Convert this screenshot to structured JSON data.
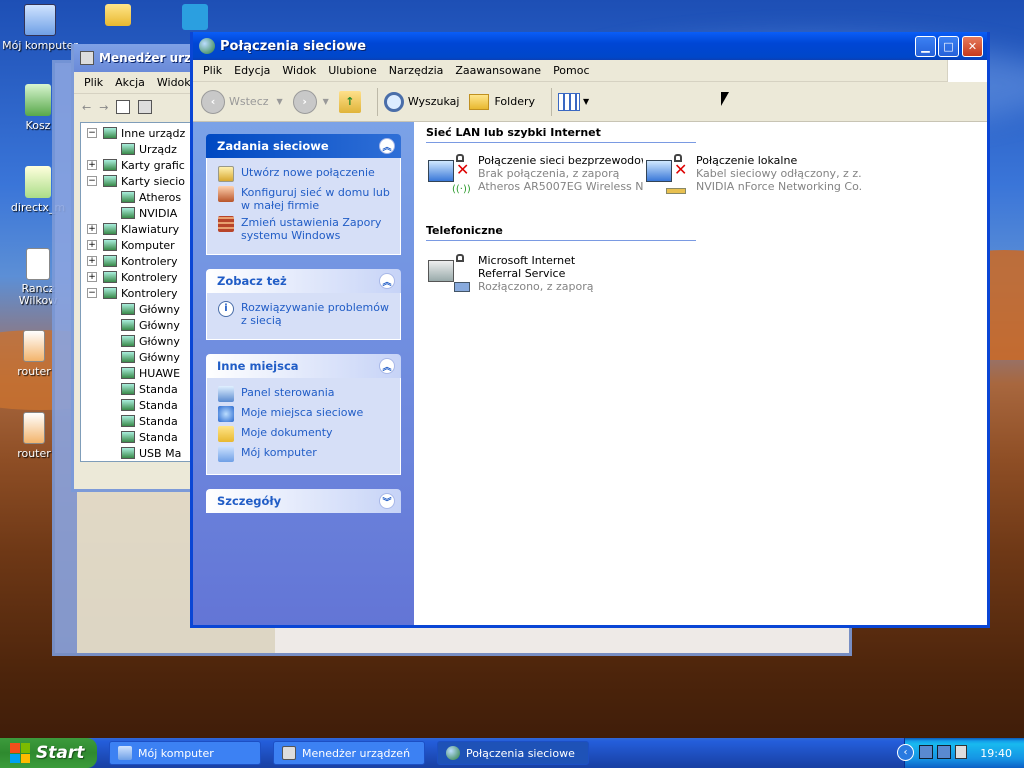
{
  "desktop": {
    "icons": [
      {
        "label": "Mój komputer"
      },
      {
        "label": "Kosz"
      },
      {
        "label": "directx_m"
      },
      {
        "label": "Rancz Wilkow"
      },
      {
        "label": "router"
      },
      {
        "label": "router"
      }
    ]
  },
  "devmgr": {
    "title": "Menedżer urzą",
    "menu": [
      "Plik",
      "Akcja",
      "Widok"
    ],
    "tree": [
      "Inne urządz",
      "Urządz",
      "Karty grafic",
      "Karty siecio",
      "Atheros",
      "NVIDIA",
      "Klawiatury",
      "Komputer",
      "Kontrolery",
      "Kontrolery",
      "Kontrolery",
      "Główny",
      "Główny",
      "Główny",
      "Główny",
      "HUAWE",
      "Standa",
      "Standa",
      "Standa",
      "Standa",
      "USB Ma"
    ]
  },
  "window": {
    "title": "Połączenia sieciowe",
    "menu": [
      "Plik",
      "Edycja",
      "Widok",
      "Ulubione",
      "Narzędzia",
      "Zaawansowane",
      "Pomoc"
    ],
    "toolbar": {
      "back": "Wstecz",
      "search": "Wyszukaj",
      "folders": "Foldery"
    }
  },
  "sidebar": {
    "tasks": {
      "title": "Zadania sieciowe",
      "items": [
        "Utwórz nowe połączenie",
        "Konfiguruj sieć w domu lub w małej firmie",
        "Zmień ustawienia Zapory systemu Windows"
      ]
    },
    "seealso": {
      "title": "Zobacz też",
      "items": [
        "Rozwiązywanie problemów z siecią"
      ]
    },
    "places": {
      "title": "Inne miejsca",
      "items": [
        "Panel sterowania",
        "Moje miejsca sieciowe",
        "Moje dokumenty",
        "Mój komputer"
      ]
    },
    "details": {
      "title": "Szczegóły"
    }
  },
  "groups": {
    "lan": {
      "header": "Sieć LAN lub szybki Internet",
      "connections": [
        {
          "name": "Połączenie sieci bezprzewodowej",
          "status": "Brak połączenia, z zaporą",
          "device": "Atheros AR5007EG Wireless N..."
        },
        {
          "name": "Połączenie lokalne",
          "status": "Kabel sieciowy odłączony, z z...",
          "device": "NVIDIA nForce Networking Co..."
        }
      ]
    },
    "phone": {
      "header": "Telefoniczne",
      "connections": [
        {
          "name": "Microsoft Internet Referral Service",
          "status": "Rozłączono, z zaporą"
        }
      ]
    }
  },
  "taskbar": {
    "start": "Start",
    "tasks": [
      "Mój komputer",
      "Menedżer urządzeń",
      "Połączenia sieciowe"
    ],
    "clock": "19:40"
  }
}
